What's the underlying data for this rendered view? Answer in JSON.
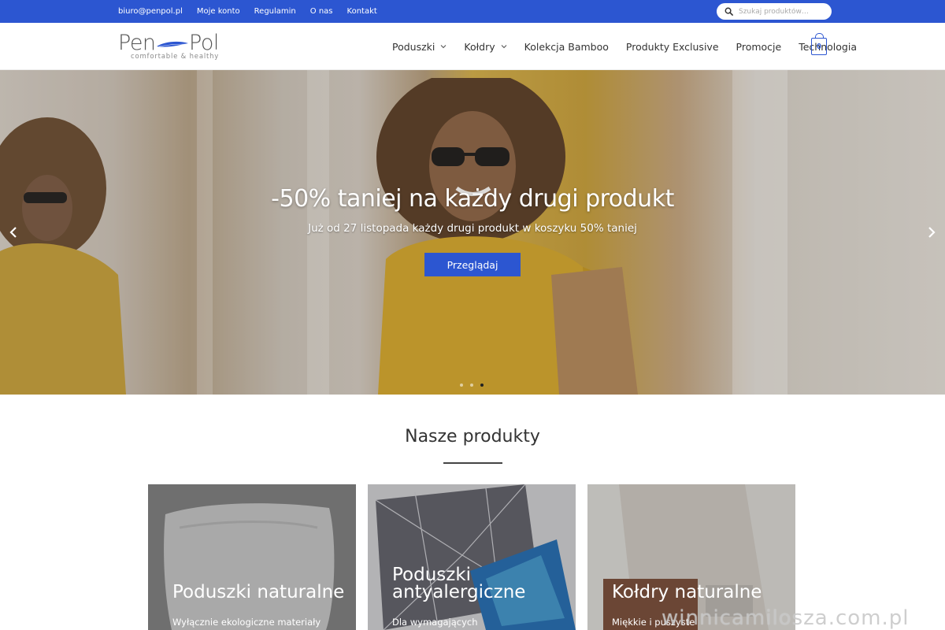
{
  "topbar": {
    "links": [
      "biuro@penpol.pl",
      "Moje konto",
      "Regulamin",
      "O nas",
      "Kontakt"
    ],
    "search_placeholder": "Szukaj produktów…"
  },
  "logo": {
    "left_word": "Pen",
    "right_word": "Pol",
    "tagline": "comfortable & healthy"
  },
  "nav": {
    "items": [
      {
        "label": "Poduszki",
        "dropdown": true
      },
      {
        "label": "Kołdry",
        "dropdown": true
      },
      {
        "label": "Kolekcja Bamboo",
        "dropdown": false
      },
      {
        "label": "Produkty Exclusive",
        "dropdown": false
      },
      {
        "label": "Promocje",
        "dropdown": false
      },
      {
        "label": "Technologia",
        "dropdown": false
      }
    ],
    "cart_count": "0"
  },
  "hero": {
    "title": "-50% taniej na każdy drugi produkt",
    "subtitle": "Już od 27 listopada każdy drugi produkt w koszyku 50% taniej",
    "button": "Przeglądaj",
    "slides": 3,
    "active_slide": 3
  },
  "products": {
    "title": "Nasze produkty",
    "cards": [
      {
        "title": "Poduszki naturalne",
        "subtitle": "Wyłącznie ekologiczne materiały"
      },
      {
        "title": "Poduszki antyalergiczne",
        "subtitle": "Dla wymagających"
      },
      {
        "title": "Kołdry naturalne",
        "subtitle": "Miękkie i puszyste"
      }
    ]
  },
  "watermark": "winnicamilosza.com.pl",
  "colors": {
    "accent": "#2c56d1",
    "text": "#333333"
  }
}
